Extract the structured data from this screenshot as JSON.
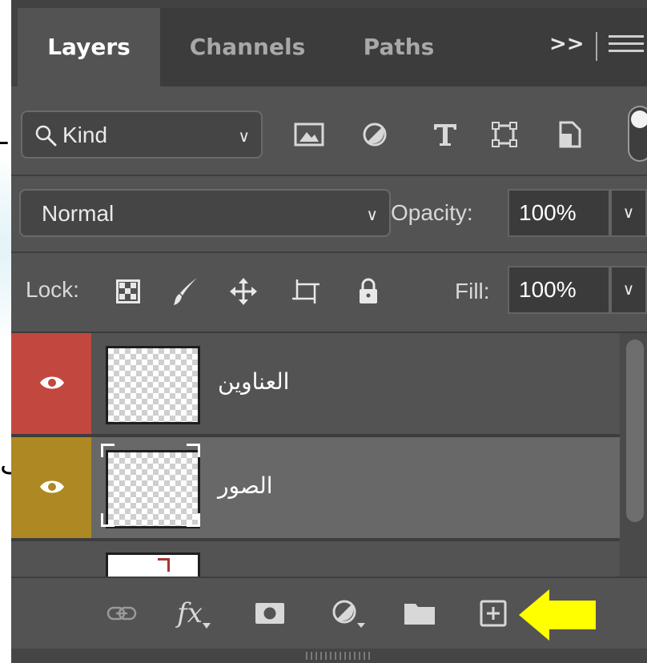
{
  "background": {
    "fragment_top": "ـ",
    "fragment_mid": "ف"
  },
  "tabs": {
    "layers": "Layers",
    "channels": "Channels",
    "paths": "Paths",
    "overflow": ">>"
  },
  "filter": {
    "kind_label": "Kind",
    "icons": [
      "pixel-layer-filter-icon",
      "adjustment-layer-filter-icon",
      "type-layer-filter-icon",
      "shape-layer-filter-icon",
      "smart-object-filter-icon"
    ],
    "toggle_on": true
  },
  "blend": {
    "mode": "Normal",
    "opacity_label": "Opacity:",
    "opacity_value": "100%"
  },
  "lock": {
    "label": "Lock:",
    "fill_label": "Fill:",
    "fill_value": "100%"
  },
  "layers": [
    {
      "name": "العناوين",
      "visible": true,
      "color_tag": "#c2473f",
      "selected": false
    },
    {
      "name": "الصور",
      "visible": true,
      "color_tag": "#ae8823",
      "selected": true
    },
    {
      "name": "",
      "visible": true,
      "color_tag": "",
      "selected": false
    }
  ],
  "bottom_bar": {
    "fx_label": "fx",
    "icons": [
      "link-layers-icon",
      "layer-style-icon",
      "add-mask-icon",
      "adjustment-layer-icon",
      "new-group-icon",
      "new-layer-icon"
    ]
  },
  "colors": {
    "panel_bg": "#535353",
    "tab_bg": "#424242",
    "selected_row": "#686868",
    "annotation_arrow": "#ffff00"
  }
}
